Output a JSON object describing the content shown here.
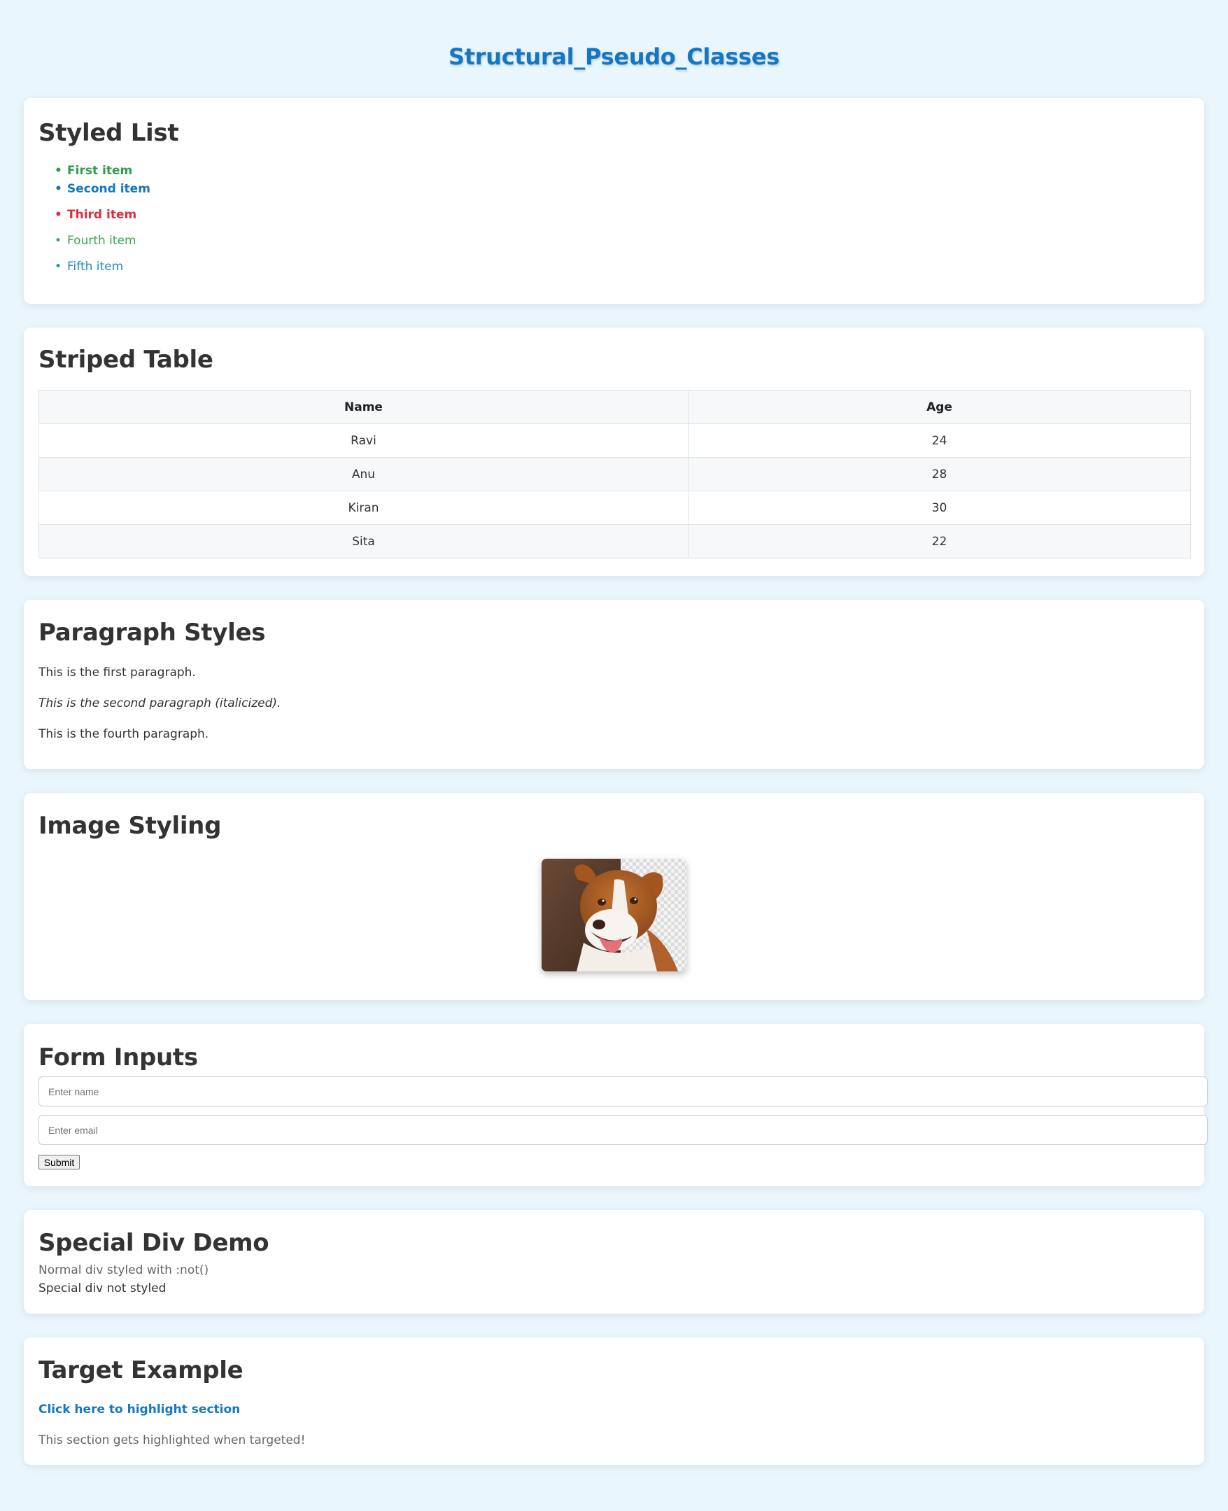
{
  "page": {
    "title": "Structural_Pseudo_Classes"
  },
  "styled_list": {
    "heading": "Styled List",
    "items": [
      {
        "label": "First item",
        "color": "#2e9e45",
        "bold": true
      },
      {
        "label": "Second item",
        "color": "#1277c4",
        "bold": true
      },
      {
        "label": "Third item",
        "color": "#d9303e",
        "bold": true
      },
      {
        "label": "Fourth item",
        "color": "#3aa650",
        "bold": false
      },
      {
        "label": "Fifth item",
        "color": "#1a8fc0",
        "bold": false
      }
    ]
  },
  "striped_table": {
    "heading": "Striped Table",
    "columns": [
      "Name",
      "Age"
    ],
    "rows": [
      [
        "Ravi",
        "24"
      ],
      [
        "Anu",
        "28"
      ],
      [
        "Kiran",
        "30"
      ],
      [
        "Sita",
        "22"
      ]
    ]
  },
  "paragraphs": {
    "heading": "Paragraph Styles",
    "items": [
      "This is the first paragraph.",
      "This is the second paragraph (italicized).",
      "This is the fourth paragraph."
    ]
  },
  "image_styling": {
    "heading": "Image Styling",
    "image_subject": "dog"
  },
  "form_inputs": {
    "heading": "Form Inputs",
    "name_placeholder": "Enter name",
    "email_placeholder": "Enter email",
    "submit_label": "Submit"
  },
  "special_div": {
    "heading": "Special Div Demo",
    "normal_text": "Normal div styled with :not()",
    "special_text": "Special div not styled"
  },
  "target_example": {
    "heading": "Target Example",
    "link_label": "Click here to highlight section",
    "section_text": "This section gets highlighted when targeted!"
  }
}
